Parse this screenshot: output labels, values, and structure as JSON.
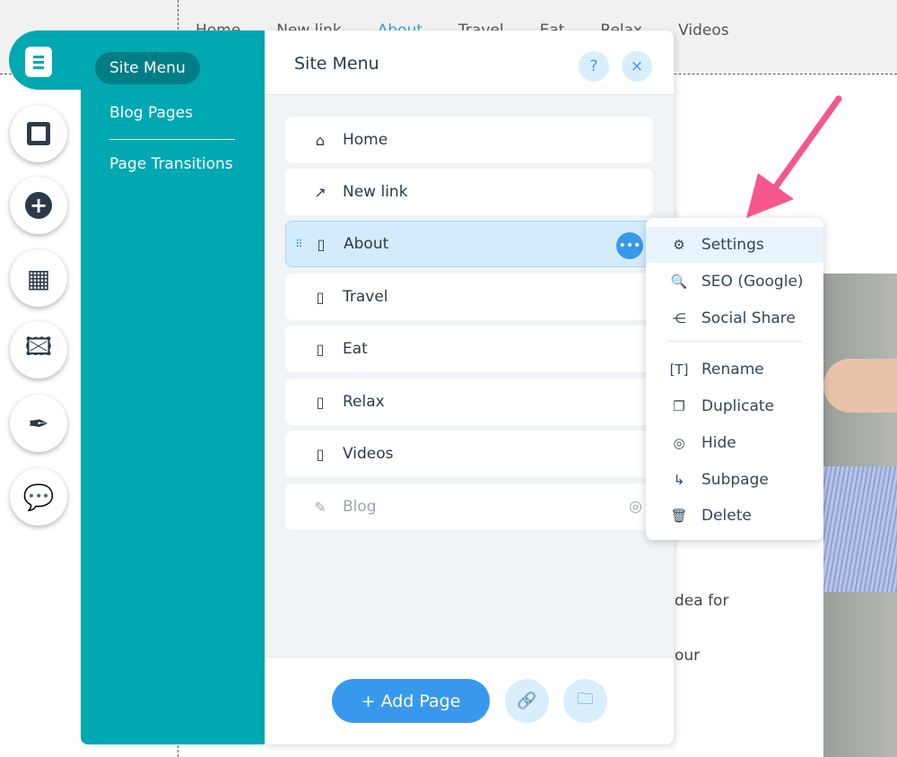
{
  "site_nav": [
    "Home",
    "New link",
    "About",
    "Travel",
    "Eat",
    "Relax",
    "Videos"
  ],
  "background_text": [
    "dea for",
    "our"
  ],
  "rail": [
    {
      "icon": "pages-icon"
    },
    {
      "icon": "background-icon"
    },
    {
      "icon": "add-icon"
    },
    {
      "icon": "add-apps-icon"
    },
    {
      "icon": "media-icon"
    },
    {
      "icon": "blog-pen-icon"
    },
    {
      "icon": "chat-icon"
    }
  ],
  "sidebar": {
    "items": [
      {
        "label": "Site Menu"
      },
      {
        "label": "Blog Pages"
      },
      {
        "label": "Page Transitions"
      }
    ]
  },
  "panel": {
    "title": "Site Menu",
    "help": "?",
    "close": "×",
    "pages": [
      {
        "label": "Home",
        "icon": "home-icon"
      },
      {
        "label": "New link",
        "icon": "external-link-icon"
      },
      {
        "label": "About",
        "icon": "page-icon"
      },
      {
        "label": "Travel",
        "icon": "page-icon"
      },
      {
        "label": "Eat",
        "icon": "page-icon"
      },
      {
        "label": "Relax",
        "icon": "page-icon"
      },
      {
        "label": "Videos",
        "icon": "page-icon"
      },
      {
        "label": "Blog",
        "icon": "blog-pen-icon"
      }
    ],
    "add_page": "+ Add Page"
  },
  "context_menu": {
    "items": [
      {
        "label": "Settings"
      },
      {
        "label": "SEO (Google)"
      },
      {
        "label": "Social Share"
      },
      {
        "label": "Rename"
      },
      {
        "label": "Duplicate"
      },
      {
        "label": "Hide"
      },
      {
        "label": "Subpage"
      },
      {
        "label": "Delete"
      }
    ]
  },
  "colors": {
    "teal": "#00a8b1",
    "accent": "#3899ec",
    "arrow": "#f5578c"
  }
}
